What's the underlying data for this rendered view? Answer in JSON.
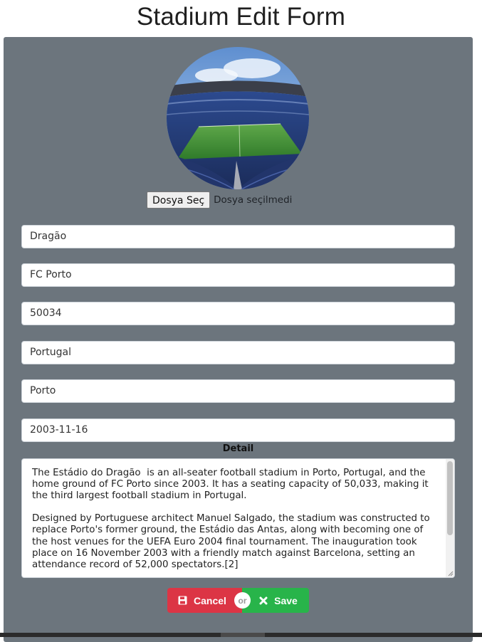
{
  "page": {
    "title": "Stadium Edit Form"
  },
  "photo": {
    "icon": "stadium-photo"
  },
  "file_input": {
    "button_label": "Dosya Seç",
    "status": "Dosya seçilmedi"
  },
  "fields": {
    "name": "Dragão",
    "club": "FC Porto",
    "capacity": "50034",
    "country": "Portugal",
    "city": "Porto",
    "opening_date": "2003-11-16"
  },
  "detail": {
    "label": "Detail",
    "text": "The Estádio do Dragão  is an all-seater football stadium in Porto, Portugal, and the home ground of FC Porto since 2003. It has a seating capacity of 50,033, making it the third largest football stadium in Portugal.\n\nDesigned by Portuguese architect Manuel Salgado, the stadium was constructed to replace Porto's former ground, the Estádio das Antas, along with becoming one of the host venues for the UEFA Euro 2004 final tournament. The inauguration took place on 16 November 2003 with a friendly match against Barcelona, setting an attendance record of 52,000 spectators.[2]"
  },
  "actions": {
    "cancel_label": "Cancel",
    "or_label": "or",
    "save_label": "Save",
    "cancel_icon": "save-disk-icon",
    "save_icon": "close-x-icon",
    "colors": {
      "cancel": "#dc3545",
      "save": "#28b44a"
    }
  },
  "colors": {
    "panel": "#6c757d"
  }
}
